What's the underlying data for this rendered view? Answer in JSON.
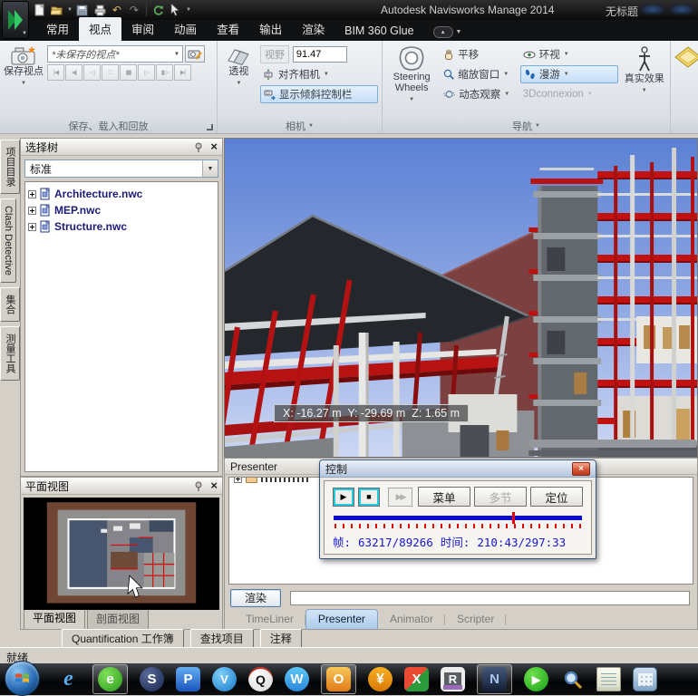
{
  "app": {
    "title": "Autodesk Navisworks Manage 2014",
    "doc_title": "无标题"
  },
  "glyphs": {
    "dropdown": "▼",
    "close": "×"
  },
  "ribbon_tabs": {
    "items": [
      "常用",
      "视点",
      "审阅",
      "动画",
      "查看",
      "输出",
      "渲染",
      "BIM 360 Glue"
    ],
    "active": "视点"
  },
  "ribbon": {
    "save_group": {
      "caption": "保存、载入和回放",
      "save_viewpoint": "保存视点",
      "viewpoint_value": "*未保存的视点*",
      "playback_glyphs": [
        "|◀",
        "◀|",
        "◁",
        "□",
        "▮▮",
        "▷",
        "▮▷",
        "▶|"
      ]
    },
    "camera_group": {
      "caption": "相机",
      "perspective": "透视",
      "fov_label": "视野",
      "fov_value": "91.47",
      "align_camera": "对齐相机",
      "tilt_bar": "显示倾斜控制栏"
    },
    "nav_group": {
      "caption": "导航",
      "steering_wheels": "Steering Wheels",
      "pan": "平移",
      "zoom_window": "缩放窗口",
      "orbit": "动态观察",
      "look_around": "环视",
      "walk": "漫游",
      "connexion": "3Dconnexion",
      "realism": "真实效果"
    }
  },
  "side_tabs": {
    "items": [
      "项目目录",
      "Clash Detective",
      "集合",
      "测量工具"
    ]
  },
  "selection_tree": {
    "title": "选择树",
    "scheme": "标准",
    "items": [
      {
        "label": "Architecture.nwc"
      },
      {
        "label": "MEP.nwc"
      },
      {
        "label": "Structure.nwc"
      }
    ]
  },
  "plan_panel": {
    "title": "平面视图",
    "tabs": [
      "平面视图",
      "剖面视图"
    ],
    "active": "平面视图"
  },
  "viewport": {
    "coordinates": "X: -16.27 m  Y: -29.69 m  Z: 1.65 m"
  },
  "presenter": {
    "title": "Presenter",
    "render_button": "渲染"
  },
  "dock_tabs": {
    "items": [
      "TimeLiner",
      "Presenter",
      "Animator",
      "Scripter"
    ],
    "active": "Presenter"
  },
  "control_dialog": {
    "title": "控制",
    "play_glyph": "▶",
    "stop_glyph": "■",
    "skip_glyph": "▶▶",
    "menu": "菜单",
    "multi": "多节",
    "locate": "定位",
    "frame_label": "帧:",
    "frame_value": "63217/89266",
    "time_label": "时间:",
    "time_value": "210:43/297:33",
    "progress_percent": 72
  },
  "bottom_tabs": {
    "items": [
      "Quantification 工作簿",
      "查找项目",
      "注释"
    ]
  },
  "statusbar": {
    "text": "就绪"
  },
  "taskbar": {
    "items": [
      {
        "name": "ie",
        "glyph": "e"
      },
      {
        "name": "browser-360",
        "glyph": "e"
      },
      {
        "name": "sogou",
        "glyph": "S"
      },
      {
        "name": "pps",
        "glyph": "P"
      },
      {
        "name": "qq-player",
        "glyph": "V"
      },
      {
        "name": "qq",
        "glyph": "Q"
      },
      {
        "name": "wangwang",
        "glyph": "W"
      },
      {
        "name": "outlook",
        "glyph": "O"
      },
      {
        "name": "pay",
        "glyph": "¥"
      },
      {
        "name": "media",
        "glyph": "X"
      },
      {
        "name": "r-app",
        "glyph": "R"
      },
      {
        "name": "navisworks",
        "glyph": "N"
      },
      {
        "name": "kankan",
        "glyph": "▶"
      }
    ]
  }
}
